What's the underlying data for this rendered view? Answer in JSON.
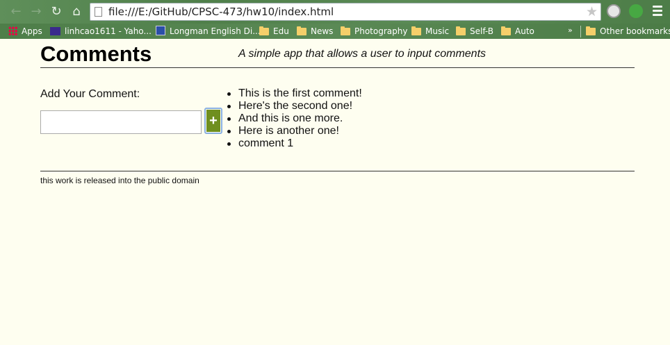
{
  "browser": {
    "url": "file:///E:/GitHub/CPSC-473/hw10/index.html",
    "bookmarks": [
      {
        "label": "Apps",
        "icon": "apps-grid-icon"
      },
      {
        "label": "linhcao1611 - Yaho...",
        "icon": "mail-icon"
      },
      {
        "label": "Longman English Di...",
        "icon": "dictionary-icon"
      },
      {
        "label": "Edu",
        "icon": "folder-icon"
      },
      {
        "label": "News",
        "icon": "folder-icon"
      },
      {
        "label": "Photography",
        "icon": "folder-icon"
      },
      {
        "label": "Music",
        "icon": "folder-icon"
      },
      {
        "label": "Self-B",
        "icon": "folder-icon"
      },
      {
        "label": "Auto",
        "icon": "folder-icon"
      }
    ],
    "overflow": "»",
    "other_bookmarks": "Other bookmarks"
  },
  "page": {
    "title": "Comments",
    "subtitle": "A simple app that allows a user to input comments",
    "add_label": "Add Your Comment:",
    "input_value": "",
    "add_button": "+",
    "comments": [
      "This is the first comment!",
      "Here's the second one!",
      "And this is one more.",
      "Here is another one!",
      "comment 1"
    ],
    "footer": "this work is released into the public domain"
  },
  "colors": {
    "page_background": "#fefef0",
    "add_button": "#6f8f1f",
    "chrome_theme": "#5a8a55"
  }
}
